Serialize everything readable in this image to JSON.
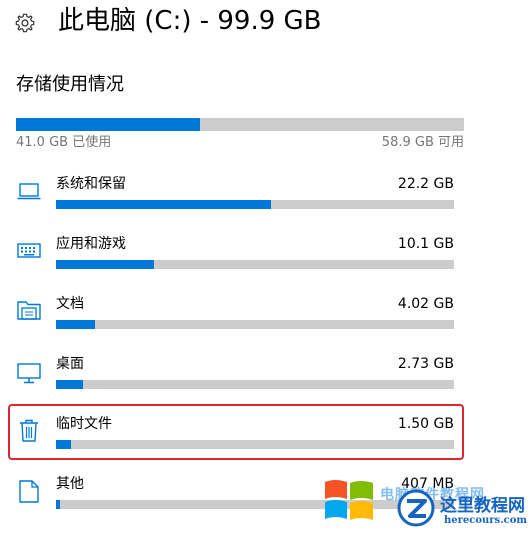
{
  "header": {
    "title": "此电脑 (C:) - 99.9 GB",
    "icon": "gear-icon"
  },
  "storage": {
    "section_title": "存储使用情况",
    "used_label": "41.0 GB 已使用",
    "free_label": "58.9 GB 可用",
    "used_fraction": 0.41
  },
  "categories": [
    {
      "name": "系统和保留",
      "size": "22.2 GB",
      "fraction": 0.54,
      "icon": "laptop-icon"
    },
    {
      "name": "应用和游戏",
      "size": "10.1 GB",
      "fraction": 0.246,
      "icon": "keyboard-icon"
    },
    {
      "name": "文档",
      "size": "4.02 GB",
      "fraction": 0.098,
      "icon": "folder-icon"
    },
    {
      "name": "桌面",
      "size": "2.73 GB",
      "fraction": 0.067,
      "icon": "monitor-icon"
    },
    {
      "name": "临时文件",
      "size": "1.50 GB",
      "fraction": 0.037,
      "icon": "trash-icon"
    },
    {
      "name": "其他",
      "size": "407 MB",
      "fraction": 0.01,
      "icon": "document-icon"
    }
  ],
  "colors": {
    "accent": "#0078d7",
    "track": "#cccccc",
    "highlight": "#d9272e"
  },
  "watermark": {
    "text_faint": "电脑软件教程网",
    "text_main": "这里教程网",
    "url": "herecours.com",
    "icon": "windows-logo-icon"
  }
}
